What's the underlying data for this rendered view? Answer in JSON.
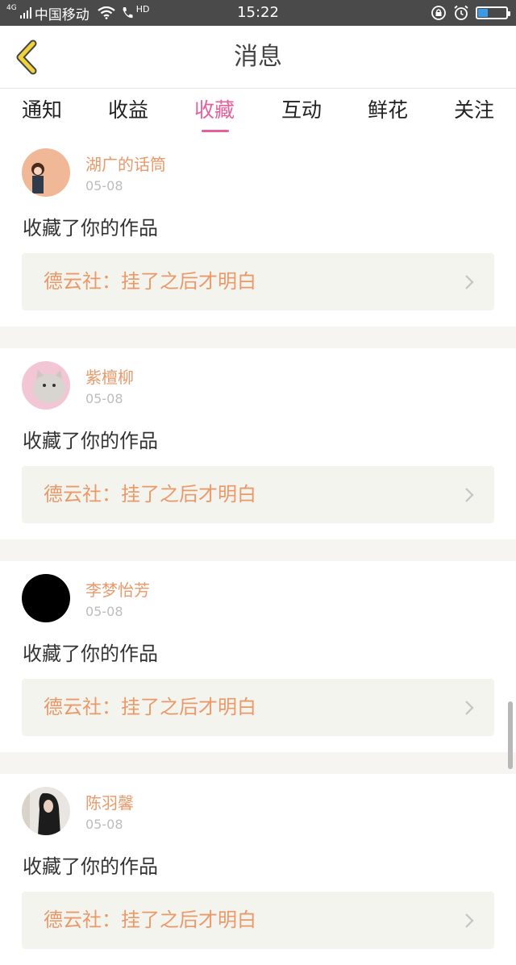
{
  "status_bar": {
    "network": "4G",
    "carrier": "中国移动",
    "hd": "HD",
    "time": "15:22",
    "battery_level": 0.35
  },
  "header": {
    "title": "消息",
    "back_icon": "chevron-left-icon"
  },
  "tabs": [
    {
      "label": "通知",
      "active": false
    },
    {
      "label": "收益",
      "active": false
    },
    {
      "label": "收藏",
      "active": true
    },
    {
      "label": "互动",
      "active": false
    },
    {
      "label": "鲜花",
      "active": false
    },
    {
      "label": "关注",
      "active": false
    }
  ],
  "notifications": [
    {
      "user": "湖广的话筒",
      "date": "05-08",
      "message": "收藏了你的作品",
      "work": "德云社：挂了之后才明白"
    },
    {
      "user": "紫檀柳",
      "date": "05-08",
      "message": "收藏了你的作品",
      "work": "德云社：挂了之后才明白"
    },
    {
      "user": "李梦怡芳",
      "date": "05-08",
      "message": "收藏了你的作品",
      "work": "德云社：挂了之后才明白"
    },
    {
      "user": "陈羽馨",
      "date": "05-08",
      "message": "收藏了你的作品",
      "work": "德云社：挂了之后才明白"
    }
  ],
  "colors": {
    "accent_pink": "#e8609a",
    "name_orange": "#e9996a",
    "back_arrow_yellow": "#f2d23a"
  }
}
